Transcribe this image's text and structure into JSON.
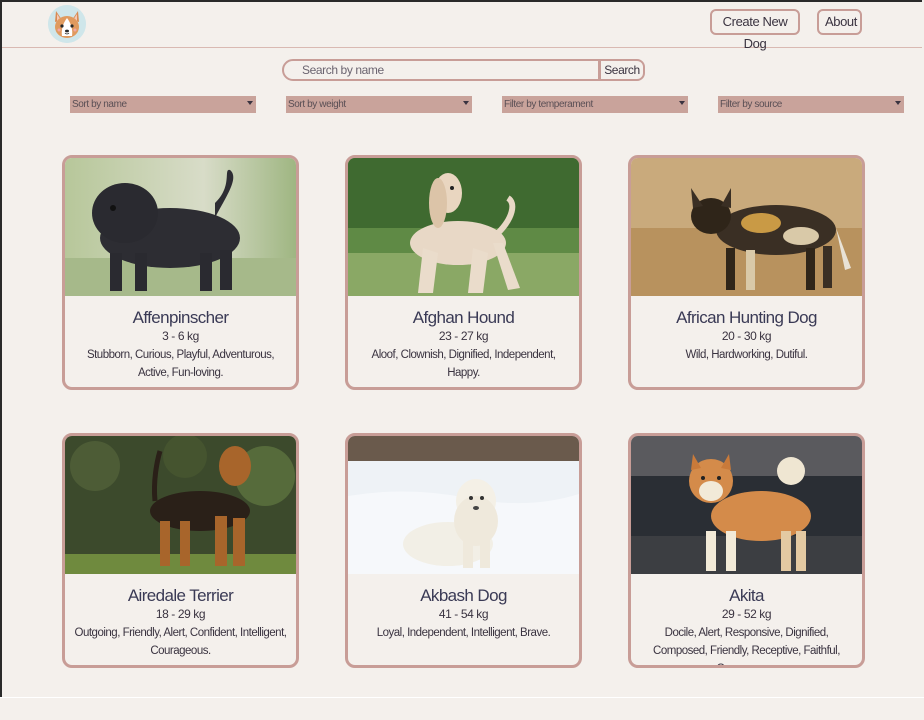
{
  "header": {
    "create_label": "Create New Dog",
    "about_label": "About"
  },
  "search": {
    "placeholder": "Search by name",
    "button_label": "Search"
  },
  "filters": [
    {
      "label": "Sort by name"
    },
    {
      "label": "Sort by weight"
    },
    {
      "label": "Filter by temperament"
    },
    {
      "label": "Filter by source"
    }
  ],
  "dogs": [
    {
      "name": "Affenpinscher",
      "weight": "3 - 6 kg",
      "temperament": "Stubborn, Curious, Playful, Adventurous, Active, Fun-loving."
    },
    {
      "name": "Afghan Hound",
      "weight": "23 - 27 kg",
      "temperament": "Aloof, Clownish, Dignified, Independent, Happy."
    },
    {
      "name": "African Hunting Dog",
      "weight": "20 - 30 kg",
      "temperament": "Wild, Hardworking, Dutiful."
    },
    {
      "name": "Airedale Terrier",
      "weight": "18 - 29 kg",
      "temperament": "Outgoing, Friendly, Alert, Confident, Intelligent, Courageous."
    },
    {
      "name": "Akbash Dog",
      "weight": "41 - 54 kg",
      "temperament": "Loyal, Independent, Intelligent, Brave."
    },
    {
      "name": "Akita",
      "weight": "29 - 52 kg",
      "temperament": "Docile, Alert, Responsive, Dignified, Composed, Friendly, Receptive, Faithful, Courageous."
    }
  ],
  "colors": {
    "accent_border": "#c89d97",
    "select_bg": "#c9a39b",
    "background": "#f4f0ec"
  }
}
